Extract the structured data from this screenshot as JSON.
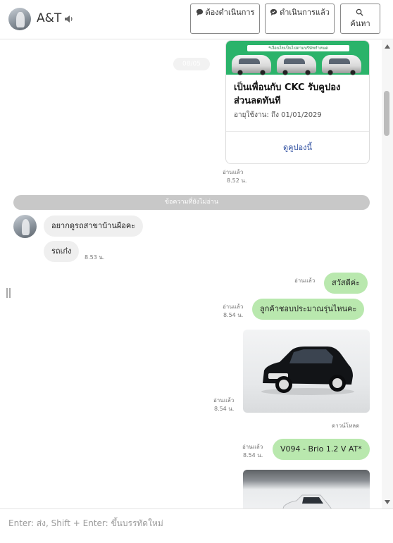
{
  "header": {
    "contact_name": "A&T",
    "buttons": {
      "pending": "ต้องดำเนินการ",
      "done": "ดำเนินการแล้ว",
      "search": "ค้นหา"
    }
  },
  "coupon": {
    "banner_text": "*เงื่อนไขเป็นไปตามบริษัทกำหนด",
    "title": "เป็นเพื่อนกับ CKC รับคูปองส่วนลดทันที",
    "expiry": "อายุใช้งาน: ถึง 01/01/2029",
    "link": "ดูคูปองนี้"
  },
  "ghost_date": "08/05",
  "labels": {
    "read": "อ่านแล้ว",
    "unread_divider": "ข้อความที่ยังไม่อ่าน",
    "download": "ดาวน์โหลด"
  },
  "messages": {
    "coupon_time": "8.52 น.",
    "in_1": "อยากดูรถสาขาบ้านผือคะ",
    "in_2": "รถเก๋ง",
    "in_2_time": "8.53 น.",
    "out_1": "สวัสดีค่ะ",
    "out_2": "ลูกค้าชอบประมาณรุ่นไหนคะ",
    "out_2_time": "8.54 น.",
    "photo_time": "8.54 น.",
    "out_3": "V094 - Brio 1.2 V AT*",
    "out_3_time": "8.54 น."
  },
  "input": {
    "placeholder": "Enter: ส่ง, Shift + Enter: ขึ้นบรรทัดใหม่"
  },
  "colors": {
    "outgoing_bubble": "#b9e8ae",
    "incoming_bubble": "#efefef",
    "coupon_green": "#2bb36a",
    "link_blue": "#2f4fa0"
  }
}
